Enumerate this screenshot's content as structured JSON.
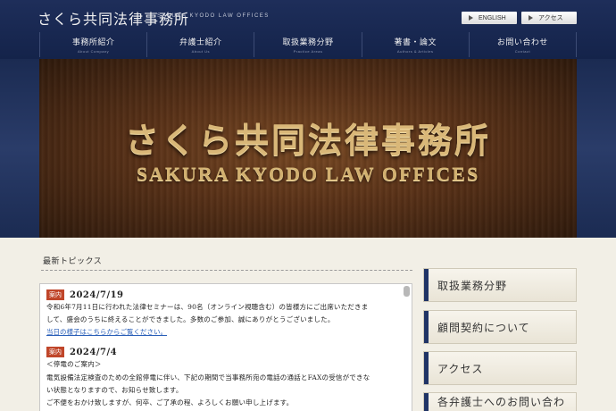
{
  "header": {
    "logo_jp": "さくら共同法律事務所",
    "logo_en": "SAKURA KYODO LAW OFFICES",
    "top_links": [
      "ENGLISH",
      "アクセス"
    ],
    "nav": [
      {
        "jp": "事務所紹介",
        "en": "About Company"
      },
      {
        "jp": "弁護士紹介",
        "en": "About Us"
      },
      {
        "jp": "取扱業務分野",
        "en": "Practice Areas"
      },
      {
        "jp": "著書・論文",
        "en": "Authors & Articles"
      },
      {
        "jp": "お問い合わせ",
        "en": "Contact"
      }
    ]
  },
  "hero": {
    "title_jp": "さくら共同法律事務所",
    "title_en": "SAKURA KYODO LAW OFFICES"
  },
  "topics": {
    "heading": "最新トピックス",
    "entries": [
      {
        "badge": "案内",
        "date": "2024/7/19",
        "lines": [
          "令和6年7月11日に行われた法律セミナーは、90名（オンライン視聴含む）の皆様方にご出席いただきま",
          "して、盛会のうちに終えることができました。多数のご参加、誠にありがとうございました。"
        ],
        "link": "当日の様子はこちらからご覧ください。"
      },
      {
        "badge": "案内",
        "date": "2024/7/4",
        "lines": [
          "＜停電のご案内＞",
          "電気設備法定検査のための全館停電に伴い、下記の期間で当事務所宛の電話の通話とFAXの受信ができな",
          "い状態となりますので、お知らせ致します。",
          "ご不便をおかけ致しますが、何卒、ご了承の程、よろしくお願い申し上げます。"
        ]
      }
    ]
  },
  "sidebar": {
    "buttons": [
      "取扱業務分野",
      "顧問契約について",
      "アクセス",
      "各弁護士へのお問い合わせ"
    ]
  },
  "colors": {
    "header_navy": "#1e2e5a",
    "badge_red": "#c0462a",
    "link_blue": "#2a5fb8",
    "sidebar_bar": "#203466"
  }
}
